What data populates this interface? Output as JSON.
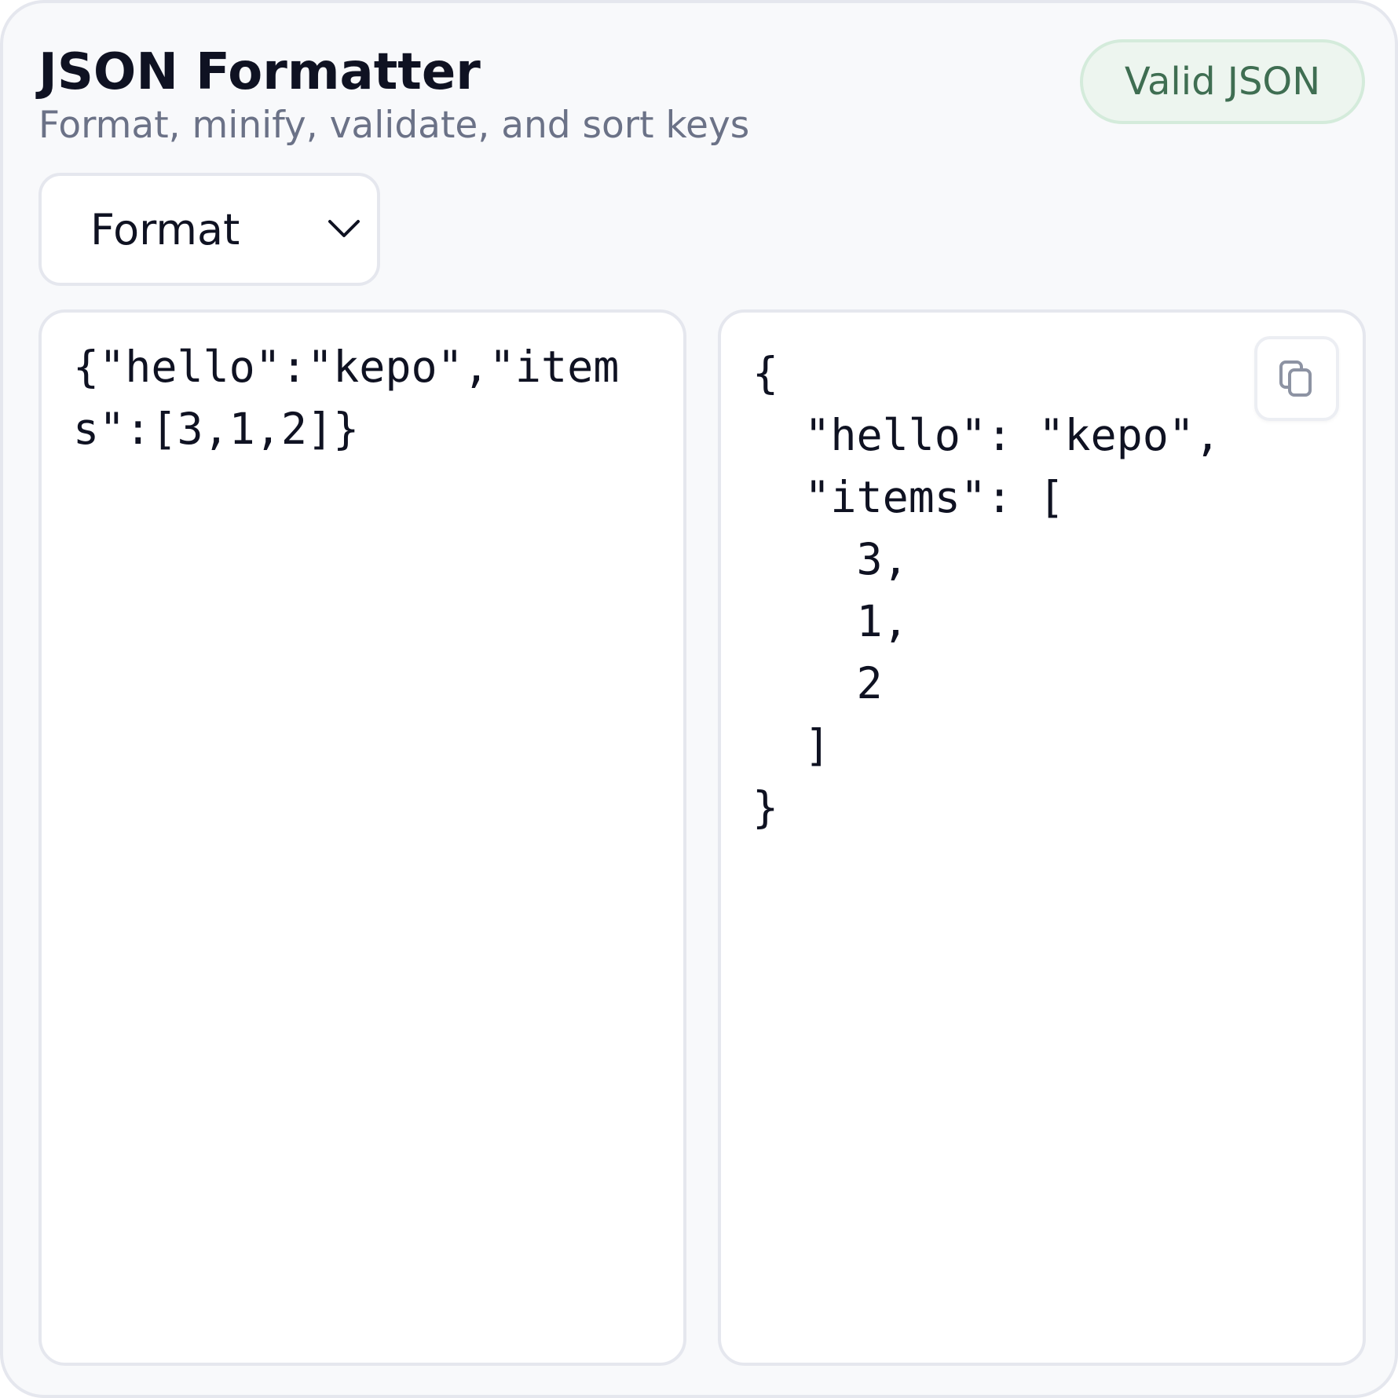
{
  "app": {
    "title": "JSON Formatter",
    "subtitle": "Format, minify, validate, and sort keys"
  },
  "status": {
    "label": "Valid JSON",
    "color": "#3f6e52",
    "background": "#edf5ef"
  },
  "mode_select": {
    "selected": "Format",
    "icon": "chevron-down-icon"
  },
  "input_pane": {
    "value": "{\"hello\":\"kepo\",\"items\":[3,1,2]}"
  },
  "output_pane": {
    "value": "{\n  \"hello\": \"kepo\",\n  \"items\": [\n    3,\n    1,\n    2\n  ]\n}",
    "copy_icon": "copy-icon"
  }
}
